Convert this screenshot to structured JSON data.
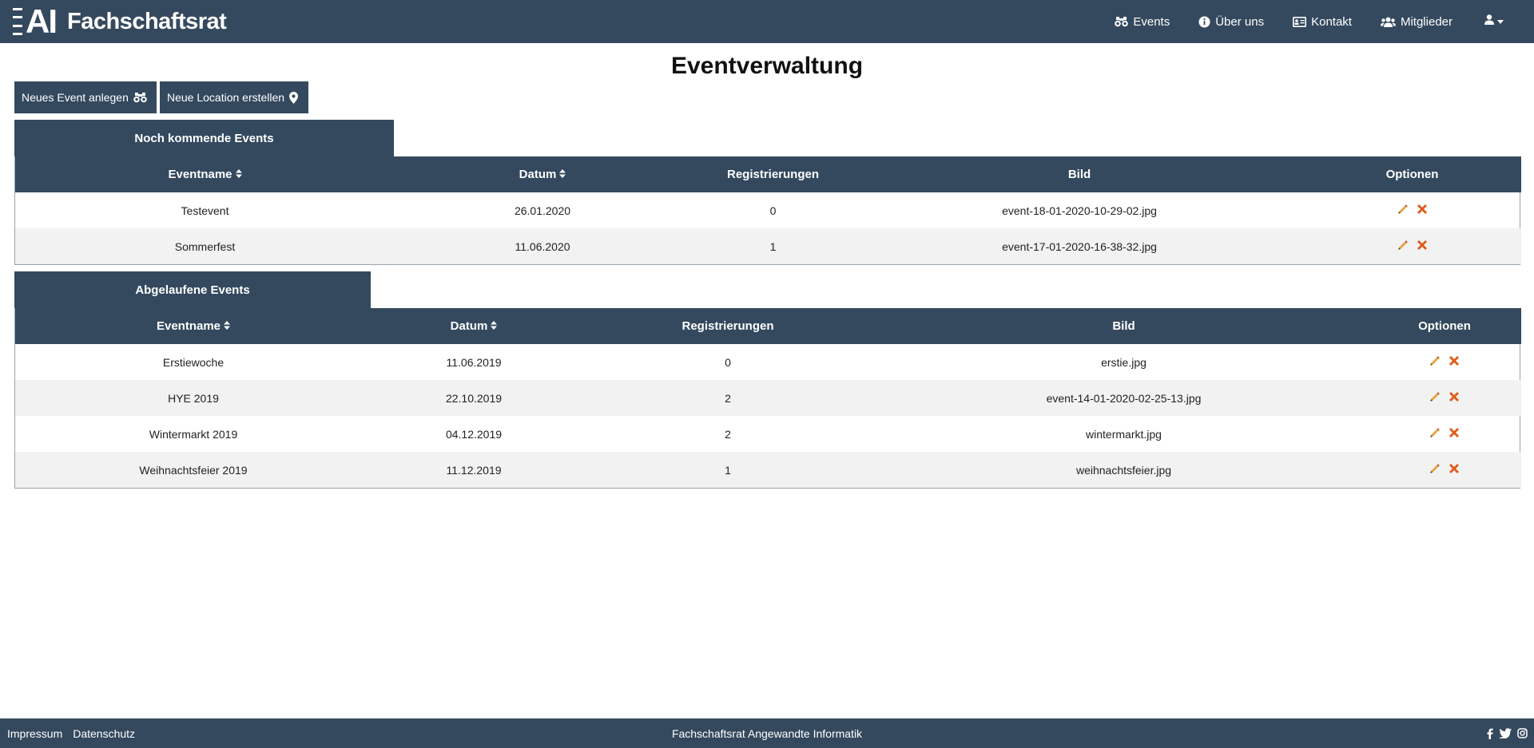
{
  "brand": {
    "logo": "AI",
    "title": "Fachschaftsrat"
  },
  "nav": {
    "items": [
      {
        "label": "Events",
        "icon": "binoculars-icon"
      },
      {
        "label": "Über uns",
        "icon": "info-icon"
      },
      {
        "label": "Kontakt",
        "icon": "contact-card-icon"
      },
      {
        "label": "Mitglieder",
        "icon": "users-icon"
      }
    ],
    "user_icon": "user-icon"
  },
  "page_title": "Eventverwaltung",
  "buttons": {
    "new_event": "Neues Event anlegen",
    "new_location": "Neue Location erstellen"
  },
  "upcoming": {
    "title": "Noch kommende Events",
    "columns": [
      "Eventname",
      "Datum",
      "Registrierungen",
      "Bild",
      "Optionen"
    ],
    "rows": [
      {
        "name": "Testevent",
        "date": "26.01.2020",
        "registrations": "0",
        "image": "event-18-01-2020-10-29-02.jpg"
      },
      {
        "name": "Sommerfest",
        "date": "11.06.2020",
        "registrations": "1",
        "image": "event-17-01-2020-16-38-32.jpg"
      }
    ]
  },
  "past": {
    "title": "Abgelaufene Events",
    "columns": [
      "Eventname",
      "Datum",
      "Registrierungen",
      "Bild",
      "Optionen"
    ],
    "rows": [
      {
        "name": "Erstiewoche",
        "date": "11.06.2019",
        "registrations": "0",
        "image": "erstie.jpg"
      },
      {
        "name": "HYE 2019",
        "date": "22.10.2019",
        "registrations": "2",
        "image": "event-14-01-2020-02-25-13.jpg"
      },
      {
        "name": "Wintermarkt 2019",
        "date": "04.12.2019",
        "registrations": "2",
        "image": "wintermarkt.jpg"
      },
      {
        "name": "Weihnachtsfeier 2019",
        "date": "11.12.2019",
        "registrations": "1",
        "image": "weihnachtsfeier.jpg"
      }
    ]
  },
  "footer": {
    "impressum": "Impressum",
    "datenschutz": "Datenschutz",
    "center": "Fachschaftsrat Angewandte Informatik",
    "social": [
      "facebook-icon",
      "twitter-icon",
      "instagram-icon"
    ]
  },
  "colors": {
    "primary": "#34495e",
    "edit": "#e8a33c",
    "delete": "#e05a1b",
    "row_alt": "#f2f2f2"
  }
}
